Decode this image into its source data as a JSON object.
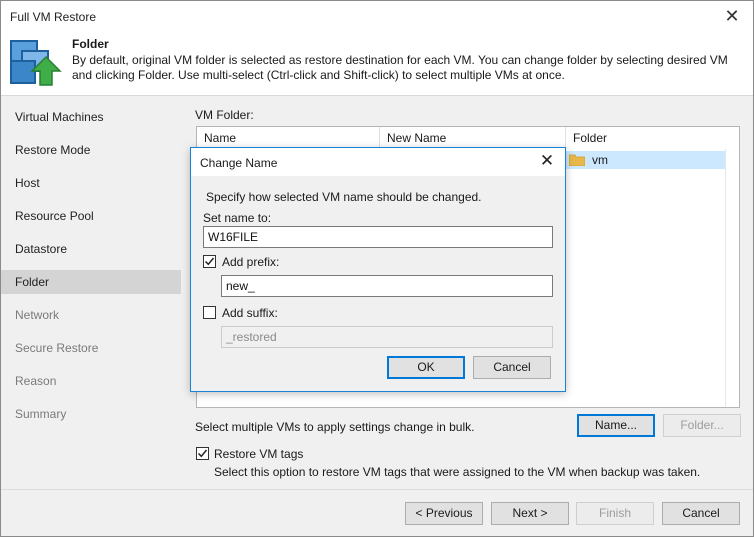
{
  "window": {
    "title": "Full VM Restore"
  },
  "header": {
    "title": "Folder",
    "description": "By default, original VM folder is selected as restore destination for each VM. You can change folder by selecting desired VM and clicking Folder. Use multi-select (Ctrl-click and Shift-click) to select multiple VMs at once."
  },
  "nav": {
    "items": [
      {
        "label": "Virtual Machines"
      },
      {
        "label": "Restore Mode"
      },
      {
        "label": "Host"
      },
      {
        "label": "Resource Pool"
      },
      {
        "label": "Datastore"
      },
      {
        "label": "Folder"
      },
      {
        "label": "Network"
      },
      {
        "label": "Secure Restore"
      },
      {
        "label": "Reason"
      },
      {
        "label": "Summary"
      }
    ],
    "active": "Folder"
  },
  "content": {
    "vm_folder_label": "VM Folder:",
    "columns": [
      "Name",
      "New Name",
      "Folder"
    ],
    "rows": [
      {
        "name": "",
        "new_name": "",
        "folder": "vm"
      }
    ],
    "bulk_hint": "Select multiple VMs to apply settings change in bulk.",
    "name_button": "Name...",
    "folder_button": "Folder...",
    "restore_tags_label": "Restore VM tags",
    "restore_tags_checked": true,
    "restore_tags_hint": "Select this option to restore VM tags that were assigned to the VM when backup was taken."
  },
  "footer": {
    "previous": "< Previous",
    "next": "Next >",
    "finish": "Finish",
    "cancel": "Cancel"
  },
  "dialog": {
    "title": "Change Name",
    "instruction": "Specify how selected VM name should be changed.",
    "set_name_label": "Set name to:",
    "set_name_value": "W16FILE",
    "add_prefix_label": "Add prefix:",
    "add_prefix_checked": true,
    "prefix_value": "new_",
    "add_suffix_label": "Add suffix:",
    "add_suffix_checked": false,
    "suffix_value": "_restored",
    "ok": "OK",
    "cancel": "Cancel"
  },
  "colors": {
    "accent": "#0078d7",
    "selection": "#cce8ff",
    "folder": "#e8b84a",
    "header_icon": "#2a7bc0",
    "header_arrow": "#3fae49"
  }
}
